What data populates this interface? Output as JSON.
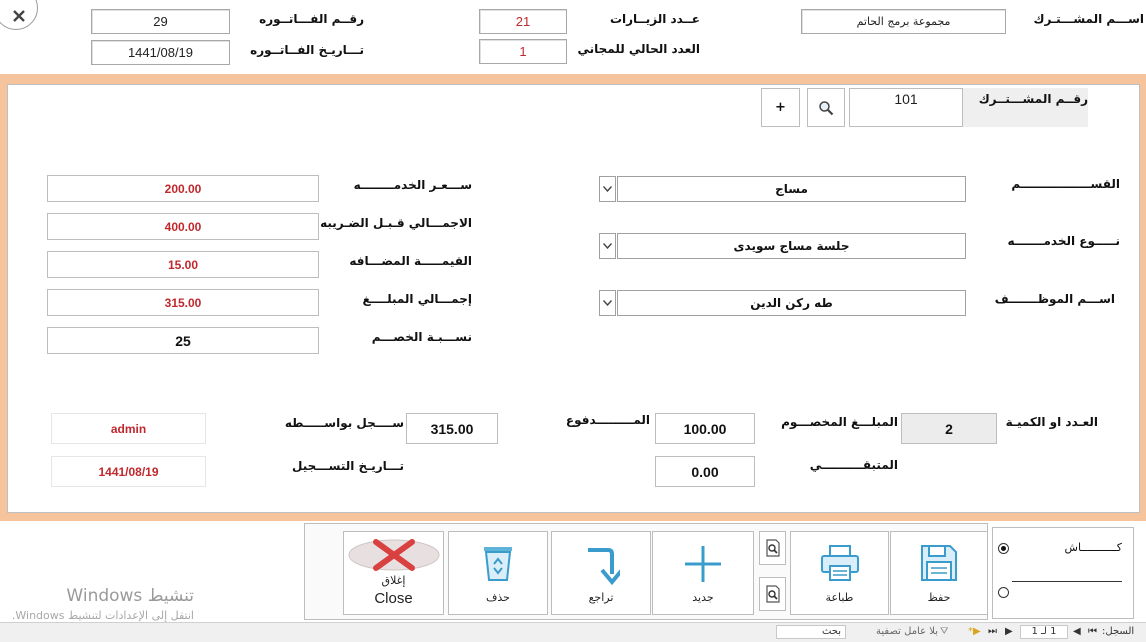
{
  "header": {
    "invoice_number_label": "رقــم الفـــاتــوره",
    "invoice_number": "29",
    "invoice_date_label": "تـــاريـخ الفــاتــوره",
    "invoice_date": "1441/08/19",
    "visits_label": "عــدد الزيــارات",
    "visits": "21",
    "free_count_label": "العدد الحالي للمجاني",
    "free_count": "1",
    "subscriber_name_label": "اســـم المشـــتـرك",
    "subscriber_name": "مجموعة برمج الحاتم"
  },
  "detail": {
    "subscriber_id_label": "رقــم المشـــتــرك",
    "subscriber_id": "101",
    "add_button": "+",
    "section_label": "القســـــــــــــــــم",
    "section_value": "مساج",
    "service_type_label": "نـــــوع الخدمـــــــه",
    "service_type_value": "جلسة مساج سويدى",
    "employee_label": "اســـم الموظـــــــف",
    "employee_value": "طه ركن الدين",
    "service_price_label": "ســـعـر الخدمــــــــه",
    "service_price": "200.00",
    "total_before_tax_label": "الاجمـــالي قـبـل الضـريبه",
    "total_before_tax": "400.00",
    "vat_label": "القيمـــــة المضـــافه",
    "vat": "15.00",
    "total_amount_label": "إجمـــالي المبلــــغ",
    "total_amount": "315.00",
    "discount_pct_label": "نســـبـة الخصـــم",
    "discount_pct": "25",
    "quantity_label": "العـدد او الكميـة",
    "quantity": "2",
    "discount_amount_label": "المبلـــغ المخصـــوم",
    "discount_amount": "100.00",
    "paid_label": "المـــــــــدفوع",
    "paid": "315.00",
    "remaining_label": "المتبقــــــــــي",
    "remaining": "0.00",
    "registered_by_label": "ســــجل بواســـــطه",
    "registered_by": "admin",
    "registration_date_label": "تـــاريـخ التســـجيل",
    "registration_date": "1441/08/19"
  },
  "toolbar": {
    "close_line1": "إغلاق",
    "close_line2": "Close",
    "delete": "حذف",
    "undo": "تراجع",
    "new": "جديد",
    "print": "طباعة",
    "save": "حفظ"
  },
  "options": {
    "cash_label": "كـــــــــــاش"
  },
  "watermark": {
    "line1": "تنشيط Windows",
    "line2": "انتقل إلى الإعدادات لتنشيط Windows."
  },
  "statusbar": {
    "record_label": "السجل:",
    "record_position": "1 لـ 1",
    "filter_label": "بلا عامل تصفية",
    "search_label": "بحث"
  },
  "colors": {
    "accent_band": "#f6c49c",
    "value_red": "#c0282d",
    "close_red": "#d94040"
  }
}
